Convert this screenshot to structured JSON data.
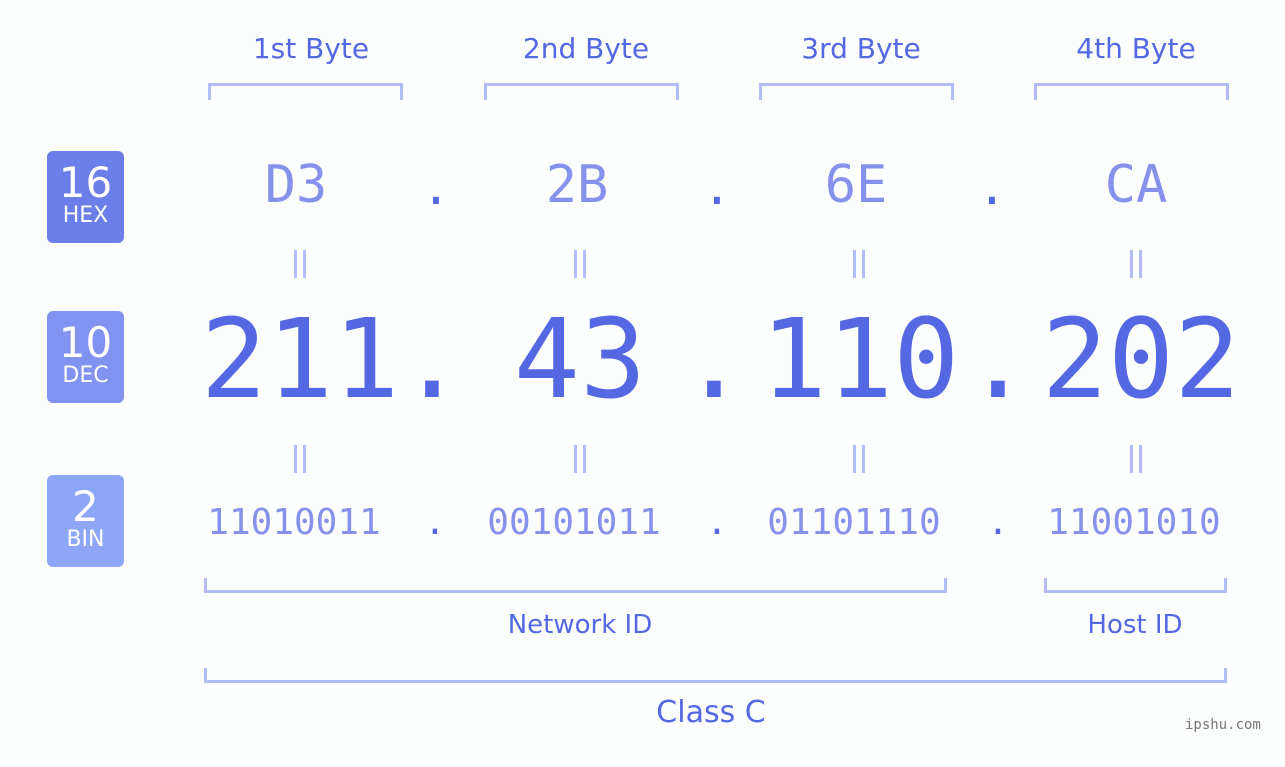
{
  "bytes": [
    {
      "label": "1st Byte",
      "hex": "D3",
      "dec": "211",
      "bin": "11010011"
    },
    {
      "label": "2nd Byte",
      "hex": "2B",
      "dec": "43",
      "bin": "00101011"
    },
    {
      "label": "3rd Byte",
      "hex": "6E",
      "dec": "110",
      "bin": "01101110"
    },
    {
      "label": "4th Byte",
      "hex": "CA",
      "dec": "202",
      "bin": "11001010"
    }
  ],
  "separator": ".",
  "badges": {
    "hex": {
      "base": "16",
      "name": "HEX",
      "color": "#6c7ee9"
    },
    "dec": {
      "base": "10",
      "name": "DEC",
      "color": "#8292f1"
    },
    "bin": {
      "base": "2",
      "name": "BIN",
      "color": "#8ea6f7"
    }
  },
  "network_id_label": "Network ID",
  "host_id_label": "Host ID",
  "class_label": "Class C",
  "watermark": "ipshu.com",
  "colors": {
    "accent": "#5468e3",
    "light": "#8591ea",
    "bracket": "#b2bcf7",
    "background": "#fcfdfd"
  }
}
